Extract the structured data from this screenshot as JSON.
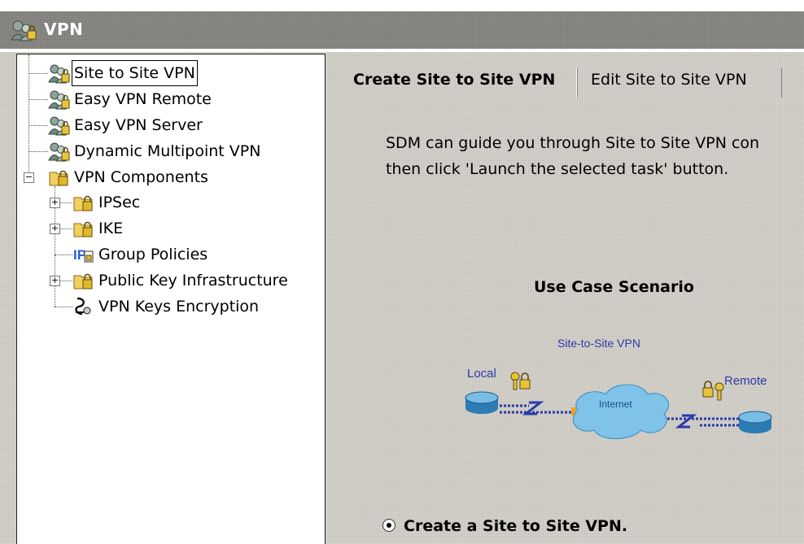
{
  "window": {
    "title": "VPN"
  },
  "tree": {
    "items": [
      {
        "label": "Site to Site VPN",
        "icon": "vpn-users-icon",
        "selected": true
      },
      {
        "label": "Easy VPN Remote",
        "icon": "vpn-users-icon"
      },
      {
        "label": "Easy VPN Server",
        "icon": "vpn-users-icon"
      },
      {
        "label": "Dynamic Multipoint VPN",
        "icon": "vpn-users-icon"
      },
      {
        "label": "VPN Components",
        "icon": "lock-folder-icon",
        "expanded": true
      },
      {
        "label": "IPSec",
        "icon": "lock-folder-icon",
        "expanded": false
      },
      {
        "label": "IKE",
        "icon": "lock-folder-icon",
        "expanded": false
      },
      {
        "label": "Group Policies",
        "icon": "ip-policy-icon"
      },
      {
        "label": "Public Key Infrastructure",
        "icon": "lock-folder-icon",
        "expanded": false
      },
      {
        "label": "VPN Keys Encryption",
        "icon": "keys-encryption-icon"
      }
    ]
  },
  "tabs": [
    {
      "label": "Create Site to Site VPN",
      "active": true
    },
    {
      "label": "Edit Site to Site VPN",
      "active": false
    }
  ],
  "content": {
    "intro_line1": "SDM can guide you through Site to Site VPN con",
    "intro_line2": "then click 'Launch the selected task' button.",
    "heading": "Use Case Scenario",
    "diagram": {
      "title": "Site-to-Site VPN",
      "local_label": "Local",
      "remote_label": "Remote",
      "cloud_label": "Internet"
    },
    "radio_label": "Create a Site to Site VPN."
  },
  "colors": {
    "title_bar": "#8c8a86",
    "diagram_text": "#2a3aa8",
    "cloud": "#7fc3e8"
  }
}
